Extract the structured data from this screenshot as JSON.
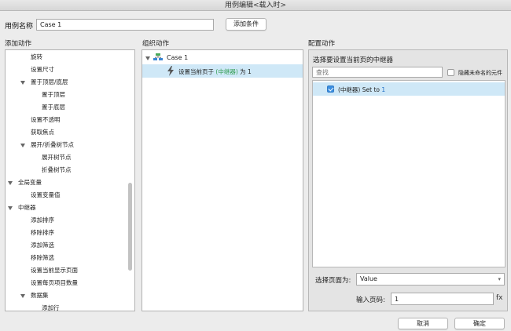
{
  "window": {
    "title": "用例编辑<载入时>"
  },
  "case_name": {
    "label": "用例名称",
    "value": "Case 1"
  },
  "add_condition_label": "添加条件",
  "add_actions": {
    "title": "添加动作",
    "items": [
      {
        "label": "旋转",
        "level": 1,
        "expand": false
      },
      {
        "label": "设置尺寸",
        "level": 1,
        "expand": false
      },
      {
        "label": "置于顶层/底层",
        "level": 1,
        "expand": true
      },
      {
        "label": "置于顶层",
        "level": 2,
        "expand": false
      },
      {
        "label": "置于底层",
        "level": 2,
        "expand": false
      },
      {
        "label": "设置不透明",
        "level": 1,
        "expand": false
      },
      {
        "label": "获取焦点",
        "level": 1,
        "expand": false
      },
      {
        "label": "展开/折叠树节点",
        "level": 1,
        "expand": true
      },
      {
        "label": "展开树节点",
        "level": 2,
        "expand": false
      },
      {
        "label": "折叠树节点",
        "level": 2,
        "expand": false
      },
      {
        "label": "全局变量",
        "level": 0,
        "expand": true
      },
      {
        "label": "设置变量值",
        "level": 1,
        "expand": false
      },
      {
        "label": "中继器",
        "level": 0,
        "expand": true
      },
      {
        "label": "添加排序",
        "level": 1,
        "expand": false
      },
      {
        "label": "移除排序",
        "level": 1,
        "expand": false
      },
      {
        "label": "添加筛选",
        "level": 1,
        "expand": false
      },
      {
        "label": "移除筛选",
        "level": 1,
        "expand": false
      },
      {
        "label": "设置当前显示页面",
        "level": 1,
        "expand": false
      },
      {
        "label": "设置每页项目数量",
        "level": 1,
        "expand": false
      },
      {
        "label": "数据集",
        "level": 1,
        "expand": true
      },
      {
        "label": "添加行",
        "level": 2,
        "expand": false
      }
    ]
  },
  "organize": {
    "title": "组织动作",
    "case_label": "Case 1",
    "action_prefix": "设置当前页于",
    "action_target": "(中继器)",
    "action_suffix": "为 1"
  },
  "config": {
    "title": "配置动作",
    "subtitle": "选择要设置当前页的中继器",
    "search_placeholder": "查找",
    "hide_unnamed_label": "隐藏未命名的元件",
    "item_target": "(中继器)",
    "item_set": "Set to",
    "item_value": "1",
    "select_page_label": "选择页面为:",
    "select_page_value": "Value",
    "page_input_label": "输入页码:",
    "page_input_value": "1",
    "fx_label": "fx"
  },
  "footer": {
    "cancel_label": "取消",
    "ok_label": "确定"
  },
  "colors": {
    "selection": "#cfe8f7",
    "link_green": "#2e9b4e",
    "value_blue": "#1f6fc7",
    "check_blue": "#3c8fe0"
  }
}
